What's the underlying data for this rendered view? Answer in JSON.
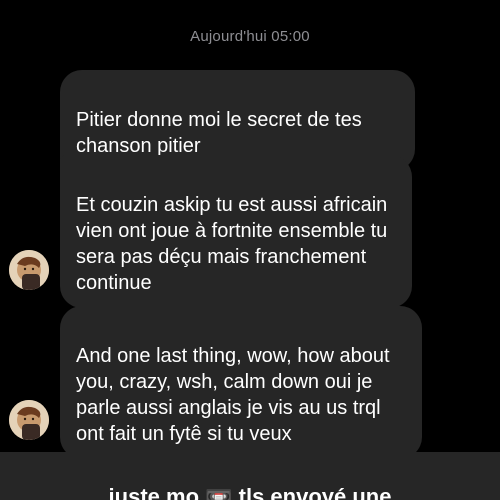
{
  "chat": {
    "timestamp": "Aujourd'hui 05:00",
    "messages": [
      {
        "text": "Pitier donne moi le secret de tes chanson pitier"
      },
      {
        "text": "Et couzin askip tu est aussi africain vien ont joue à fortnite ensemble tu sera pas déçu mais franchement continue"
      },
      {
        "text": "And one last thing, wow, how about you, crazy, wsh, calm down oui je parle aussi anglais  je vis au us trql ont fait un fytê si tu veux"
      }
    ]
  },
  "bottom": {
    "text": "juste mo 📼 tls envoyé une"
  },
  "icons": {
    "avatar": "user-avatar"
  },
  "colors": {
    "background": "#000000",
    "bubble": "#262626",
    "timestamp": "#8e8e93",
    "text": "#ffffff"
  }
}
